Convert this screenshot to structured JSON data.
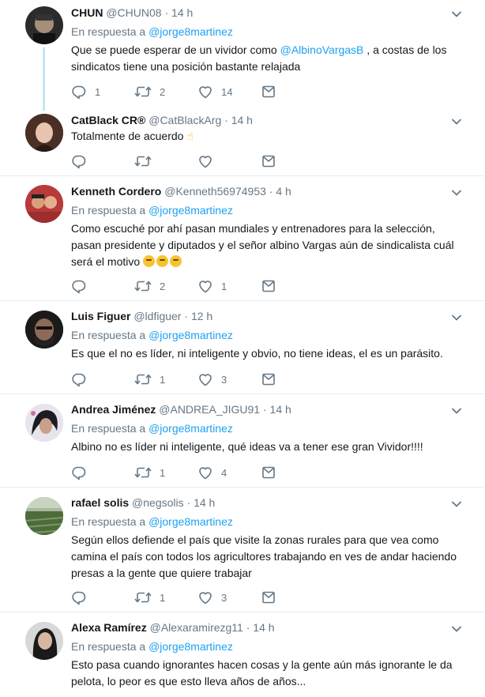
{
  "icons": {
    "chevron": "chevron-down-icon",
    "reply": "reply-icon",
    "retweet": "retweet-icon",
    "like": "heart-icon",
    "dm": "envelope-icon"
  },
  "colors": {
    "link": "#1da1f2",
    "muted": "#657786",
    "thread": "#c4e6f7"
  },
  "tweets": [
    {
      "name": "CHUN",
      "handle": "@CHUN08",
      "time": "14 h",
      "reply_prefix": "En respuesta a",
      "reply_user": "@jorge8martinez",
      "text_a": "Que se puede esperar de un vividor como ",
      "mention": "@AlbinoVargasB",
      "text_b": " , a costas de los sindicatos tiene una posición bastante relajada",
      "replies": "1",
      "retweets": "2",
      "likes": "14"
    },
    {
      "name": "CatBlack CR®",
      "handle": "@CatBlackArg",
      "time": "14 h",
      "text": "Totalmente de acuerdo ",
      "replies": "",
      "retweets": "",
      "likes": ""
    },
    {
      "name": "Kenneth Cordero",
      "handle": "@Kenneth56974953",
      "time": "4 h",
      "reply_prefix": "En respuesta a",
      "reply_user": "@jorge8martinez",
      "text": "Como escuché por ahí pasan mundiales y  entrenadores para la selección, pasan presidente y diputados y el señor albino Vargas aún de sindicalista cuál será el motivo ",
      "replies": "",
      "retweets": "2",
      "likes": "1"
    },
    {
      "name": "Luis Figuer",
      "handle": "@ldfiguer",
      "time": "12 h",
      "reply_prefix": "En respuesta a",
      "reply_user": "@jorge8martinez",
      "text": "Es que el no es líder, ni inteligente y obvio, no tiene ideas, el es un parásito.",
      "replies": "",
      "retweets": "1",
      "likes": "3"
    },
    {
      "name": "Andrea Jiménez",
      "handle": "@ANDREA_JIGU91",
      "time": "14 h",
      "reply_prefix": "En respuesta a",
      "reply_user": "@jorge8martinez",
      "text": "Albino no es líder ni inteligente, qué ideas va a tener ese gran Vividor!!!!",
      "replies": "",
      "retweets": "1",
      "likes": "4"
    },
    {
      "name": "rafael solis",
      "handle": "@negsolis",
      "time": "14 h",
      "reply_prefix": "En respuesta a",
      "reply_user": "@jorge8martinez",
      "text": "Según ellos defiende el país que visite la zonas rurales para que vea como camina el país con todos los agricultores trabajando en ves de andar haciendo presas a la gente que quiere trabajar",
      "replies": "",
      "retweets": "1",
      "likes": "3"
    },
    {
      "name": "Alexa Ramírez",
      "handle": "@Alexaramirezg11",
      "time": "14 h",
      "reply_prefix": "En respuesta a",
      "reply_user": "@jorge8martinez",
      "text": "Esto pasa cuando ignorantes hacen cosas y la gente aún más ignorante le da pelota, lo peor es que esto lleva años de años..."
    }
  ]
}
